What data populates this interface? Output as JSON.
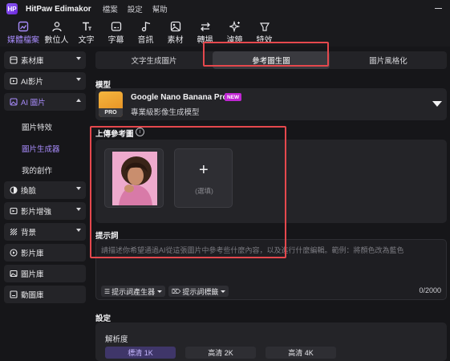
{
  "titlebar": {
    "logo_text": "HP",
    "app_title": "HitPaw Edimakor",
    "menus": [
      "檔案",
      "設定",
      "幫助"
    ]
  },
  "toolbar": {
    "items": [
      {
        "label": "媒體檔案",
        "icon": "media-files-icon",
        "active": true
      },
      {
        "label": "數位人",
        "icon": "avatar-person-icon",
        "active": false
      },
      {
        "label": "文字",
        "icon": "text-icon",
        "active": false
      },
      {
        "label": "字幕",
        "icon": "subtitle-icon",
        "active": false
      },
      {
        "label": "音訊",
        "icon": "audio-icon",
        "active": false
      },
      {
        "label": "素材",
        "icon": "materials-icon",
        "active": false
      },
      {
        "label": "轉場",
        "icon": "transition-icon",
        "active": false
      },
      {
        "label": "濾鏡",
        "icon": "filter-sparkle-icon",
        "active": false
      },
      {
        "label": "特效",
        "icon": "effects-icon",
        "active": false
      }
    ],
    "active_color": "#a78bfa"
  },
  "sidebar": {
    "items": [
      {
        "label": "素材庫",
        "icon": "library-icon",
        "chevron": "down"
      },
      {
        "label": "AI影片",
        "icon": "ai-video-icon",
        "chevron": "down"
      },
      {
        "label": "AI 圖片",
        "icon": "ai-image-icon",
        "chevron": "up",
        "active": true
      },
      {
        "label": "換臉",
        "icon": "face-swap-icon",
        "chevron": "down"
      },
      {
        "label": "影片增強",
        "icon": "video-enhance-icon",
        "chevron": "down"
      },
      {
        "label": "背景",
        "icon": "background-icon",
        "chevron": "down"
      },
      {
        "label": "影片庫",
        "icon": "video-library-icon"
      },
      {
        "label": "圖片庫",
        "icon": "image-library-icon"
      },
      {
        "label": "動圖庫",
        "icon": "gif-library-icon"
      }
    ],
    "sub_items": [
      {
        "label": "圖片特效",
        "active": false
      },
      {
        "label": "圖片生成器",
        "active": true
      },
      {
        "label": "我的創作",
        "active": false
      }
    ]
  },
  "main": {
    "tabs": [
      {
        "label": "文字生成圖片",
        "selected": false
      },
      {
        "label": "參考圖生圖",
        "selected": true
      },
      {
        "label": "圖片風格化",
        "selected": false
      }
    ],
    "model": {
      "section_label": "模型",
      "name": "Google Nano Banana Pro",
      "badge": "NEW",
      "badge_color": "#c026d3",
      "thumb_badge": "PRO",
      "description": "專業級影像生成模型"
    },
    "upload": {
      "section_label": "上傳參考圖",
      "info_icon": "i",
      "optional_label": "(選填)",
      "add_icon": "+"
    },
    "prompt": {
      "section_label": "提示詞",
      "placeholder": "請描述你希望通過AI從這張圖片中參考些什麼內容，以及進行什麼編輯。範例：將顏色改為藍色",
      "generator_button": "提示詞產生器",
      "tags_button": "提示詞標籤",
      "counter": "0/2000"
    },
    "settings": {
      "section_label": "設定",
      "resolution_label": "解析度",
      "options": [
        {
          "label": "標清 1K",
          "selected": true
        },
        {
          "label": "高清 2K",
          "selected": false
        },
        {
          "label": "高清 4K",
          "selected": false
        }
      ]
    }
  },
  "annotation_color": "#e5484d"
}
